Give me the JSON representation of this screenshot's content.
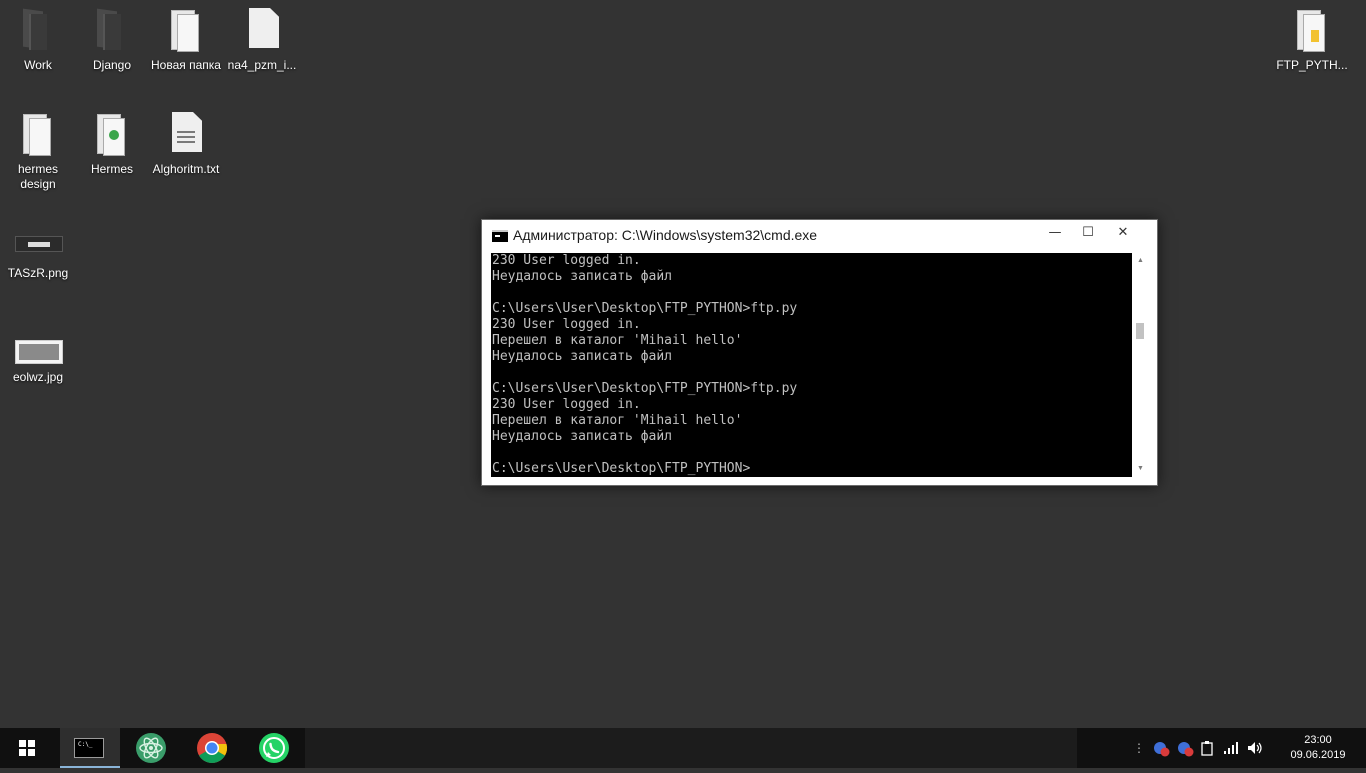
{
  "desktop": {
    "icons": [
      {
        "label": "Work"
      },
      {
        "label": "Django"
      },
      {
        "label": "Новая папка"
      },
      {
        "label": "na4_pzm_i..."
      },
      {
        "label": "hermes design"
      },
      {
        "label": "Hermes"
      },
      {
        "label": "Alghoritm.txt"
      },
      {
        "label": "TASzR.png"
      },
      {
        "label": "eolwz.jpg"
      },
      {
        "label": "FTP_PYTH..."
      }
    ]
  },
  "cmd": {
    "title": "Администратор: C:\\Windows\\system32\\cmd.exe",
    "minimize_glyph": "—",
    "maximize_glyph": "☐",
    "close_glyph": "✕",
    "scroll_up_glyph": "▲",
    "scroll_down_glyph": "▼",
    "lines": [
      "230 User logged in.",
      "Неудалось записать файл",
      "",
      "C:\\Users\\User\\Desktop\\FTP_PYTHON>ftp.py",
      "230 User logged in.",
      "Перешел в каталог 'Mihail hello'",
      "Неудалось записать файл",
      "",
      "C:\\Users\\User\\Desktop\\FTP_PYTHON>ftp.py",
      "230 User logged in.",
      "Перешел в каталог 'Mihail hello'",
      "Неудалось записать файл",
      "",
      "C:\\Users\\User\\Desktop\\FTP_PYTHON>"
    ]
  },
  "taskbar": {
    "cmd_icon_text": "C:\\_",
    "tray_badge_count": "3",
    "clock_time": "23:00",
    "clock_date": "09.06.2019"
  },
  "colors": {
    "desktop_bg": "#333333",
    "console_bg": "#000000",
    "console_fg": "#c0c0c0",
    "taskbar_bg": "#101010"
  },
  "icons": {
    "start": "windows-logo-icon",
    "atom": "atom-icon",
    "chrome": "chrome-icon",
    "whatsapp": "whatsapp-icon"
  }
}
